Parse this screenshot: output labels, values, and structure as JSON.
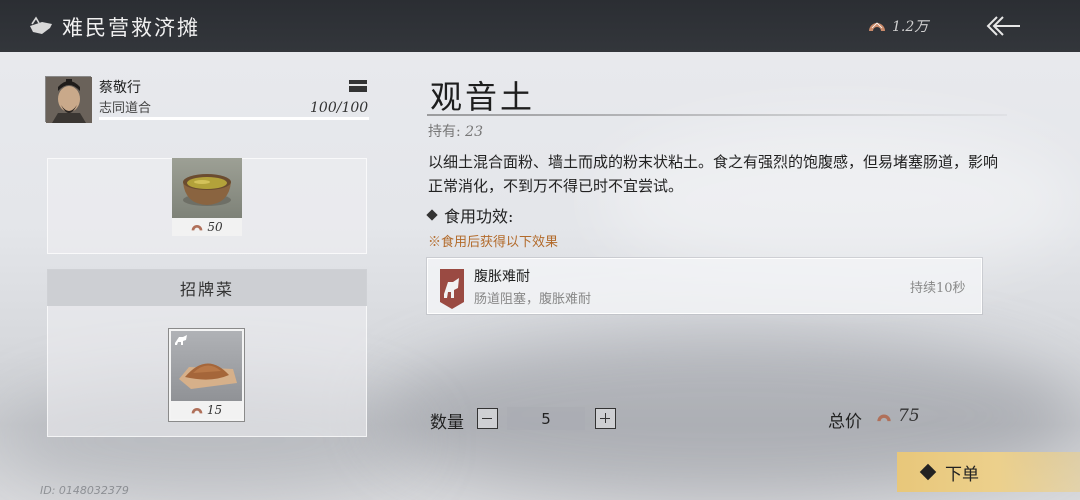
{
  "header": {
    "title": "难民营救济摊",
    "currency_amount": "1.2万"
  },
  "character": {
    "name": "蔡敬行",
    "subtitle": "志同道合",
    "stat": "100/100"
  },
  "dish_slot": {
    "price": "50"
  },
  "signature": {
    "header": "招牌菜",
    "price": "15"
  },
  "item": {
    "name": "观音土",
    "owned_label": "持有:",
    "owned_count": "23",
    "description": "以细土混合面粉、墙土而成的粉末状粘土。食之有强烈的饱腹感，但易堵塞肠道，影响正常消化，不到万不得已时不宜尝试。",
    "effect_heading": "食用功效:",
    "effect_note": "※食用后获得以下效果"
  },
  "effect": {
    "name": "腹胀难耐",
    "description": "肠道阻塞，腹胀难耐",
    "duration": "持续10秒"
  },
  "order": {
    "quantity_label": "数量",
    "quantity_value": "5",
    "total_label": "总价",
    "total_value": "75",
    "button_label": "下单"
  },
  "footer": {
    "id_text": "ID: 0148032379"
  },
  "colors": {
    "topbar": "#2b2e33",
    "accent_gold": "#e8c77a",
    "note_orange": "#b26a2a"
  }
}
